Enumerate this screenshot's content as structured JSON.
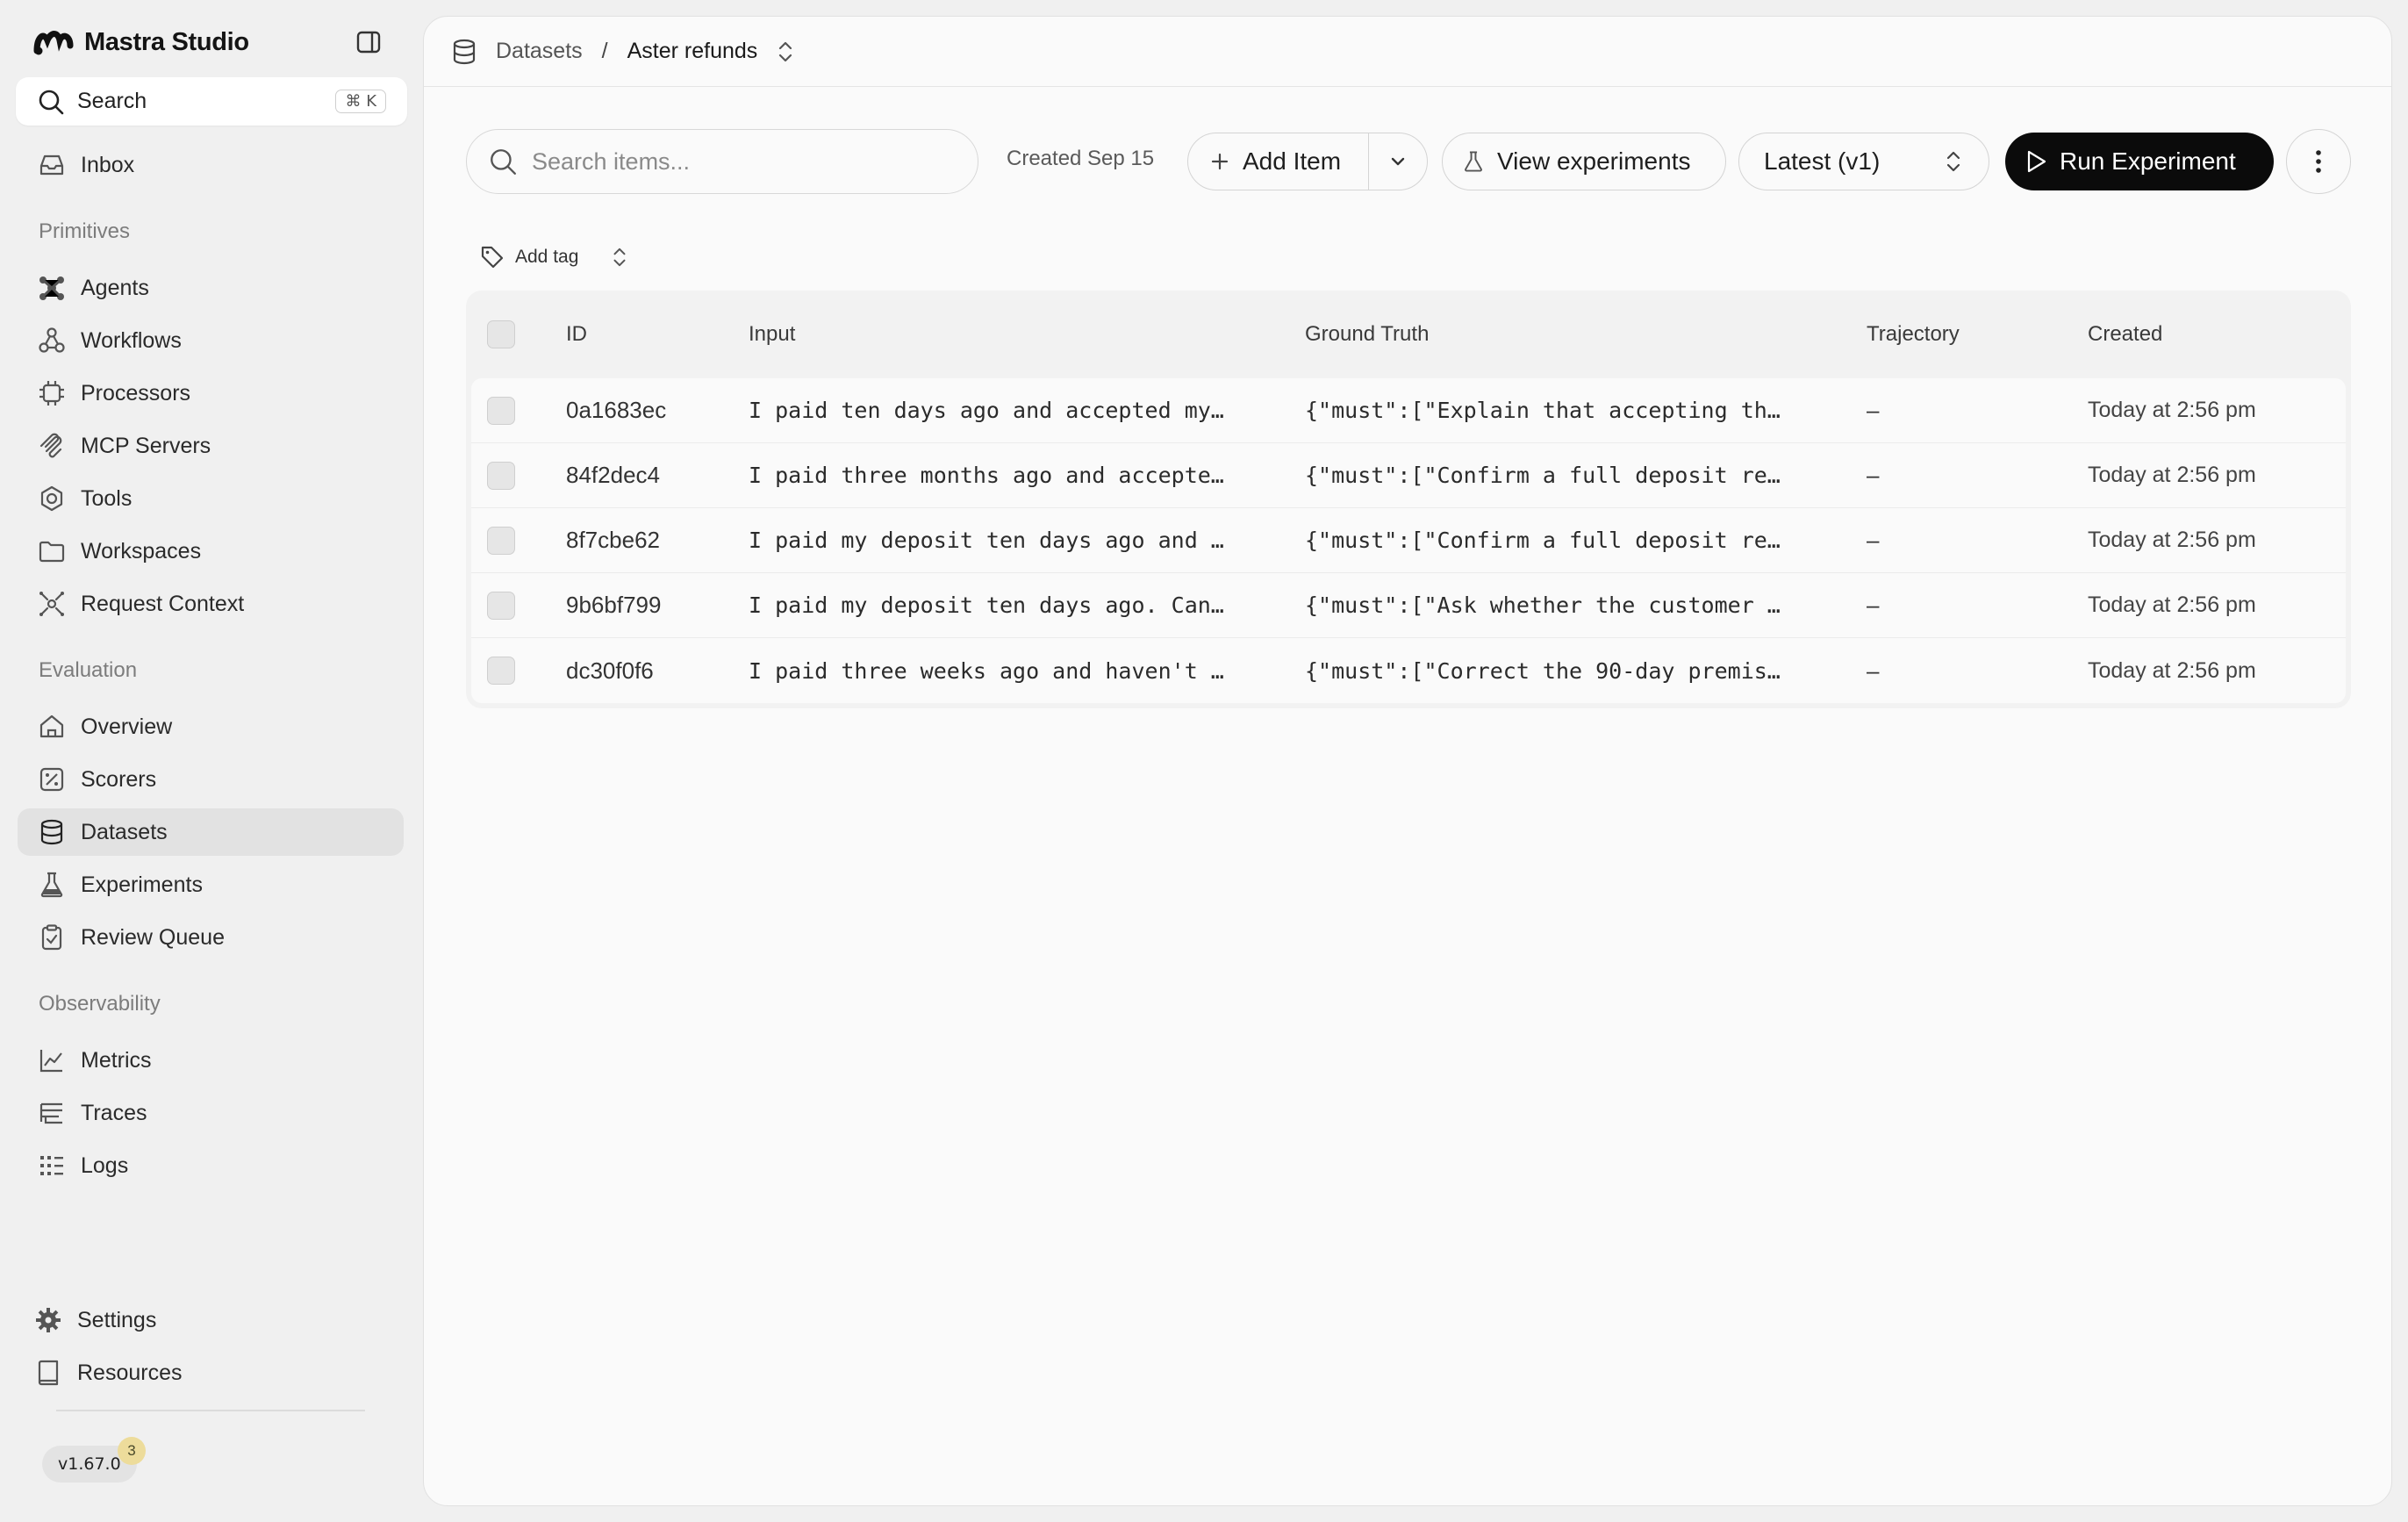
{
  "sidebar": {
    "brand": "Mastra Studio",
    "search": {
      "label": "Search",
      "shortcut": "⌘ K"
    },
    "inbox": "Inbox",
    "sections": {
      "primitives": "Primitives",
      "evaluation": "Evaluation",
      "observability": "Observability"
    },
    "primitives": [
      "Agents",
      "Workflows",
      "Processors",
      "MCP Servers",
      "Tools",
      "Workspaces",
      "Request Context"
    ],
    "evaluation": [
      "Overview",
      "Scorers",
      "Datasets",
      "Experiments",
      "Review Queue"
    ],
    "observability": [
      "Metrics",
      "Traces",
      "Logs"
    ],
    "footer": [
      "Settings",
      "Resources"
    ],
    "active_item": "Datasets",
    "version": "v1.67.0",
    "version_badge": "3"
  },
  "breadcrumb": {
    "root": "Datasets",
    "separator": "/",
    "current": "Aster refunds"
  },
  "toolbar": {
    "search_placeholder": "Search items...",
    "created": "Created Sep 15",
    "add_item": "Add Item",
    "view_experiments": "View experiments",
    "version_select": "Latest (v1)",
    "run_experiment": "Run Experiment",
    "add_tag": "Add tag"
  },
  "table": {
    "columns": [
      "ID",
      "Input",
      "Ground Truth",
      "Trajectory",
      "Created"
    ],
    "rows": [
      {
        "id": "0a1683ec",
        "input": "I paid ten days ago and accepted my…",
        "ground_truth": "{\"must\":[\"Explain that accepting th…",
        "trajectory": "–",
        "created": "Today at 2:56 pm"
      },
      {
        "id": "84f2dec4",
        "input": "I paid three months ago and accepte…",
        "ground_truth": "{\"must\":[\"Confirm a full deposit re…",
        "trajectory": "–",
        "created": "Today at 2:56 pm"
      },
      {
        "id": "8f7cbe62",
        "input": "I paid my deposit ten days ago and …",
        "ground_truth": "{\"must\":[\"Confirm a full deposit re…",
        "trajectory": "–",
        "created": "Today at 2:56 pm"
      },
      {
        "id": "9b6bf799",
        "input": "I paid my deposit ten days ago. Can…",
        "ground_truth": "{\"must\":[\"Ask whether the customer …",
        "trajectory": "–",
        "created": "Today at 2:56 pm"
      },
      {
        "id": "dc30f0f6",
        "input": "I paid three weeks ago and haven't …",
        "ground_truth": "{\"must\":[\"Correct the 90-day premis…",
        "trajectory": "–",
        "created": "Today at 2:56 pm"
      }
    ]
  },
  "colors": {
    "app_bg": "#f0f0f0",
    "panel_bg": "#fafafa",
    "active_nav": "#e2e2e2",
    "primary_button": "#0b0b0b",
    "badge": "#eddc9b"
  }
}
